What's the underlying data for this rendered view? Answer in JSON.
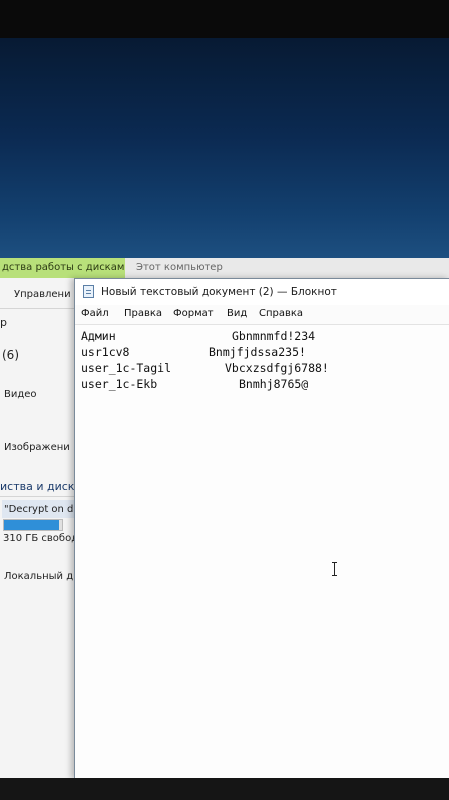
{
  "explorer": {
    "active_tab": "дства работы с дисками",
    "window_title": "Этот компьютер",
    "manage_label": "Управлени",
    "nav_partial": "р",
    "folders_count": "(6)",
    "folder_video": "Видео",
    "folder_images": "Изображени",
    "section_devices": "иства и диск",
    "drive_label": "\"Decrypt on d",
    "drive_free": "310 ГБ свобод",
    "local_disk": "Локальный д",
    "drive_used_fraction": 0.95
  },
  "notepad": {
    "title": "Новый текстовый документ (2) — Блокнот",
    "menu": [
      "Файл",
      "Правка",
      "Формат",
      "Вид",
      "Справка"
    ],
    "lines": [
      {
        "user": "Админ",
        "password": "Gbnmnmfd!234"
      },
      {
        "user": "usr1cv8",
        "password": "Bnmjfjdssa235!"
      },
      {
        "user": "user_1c-Tagil",
        "password": "Vbcxzsdfgj6788!"
      },
      {
        "user": "user_1c-Ekb",
        "password": "Bnmhj8765@"
      }
    ]
  }
}
